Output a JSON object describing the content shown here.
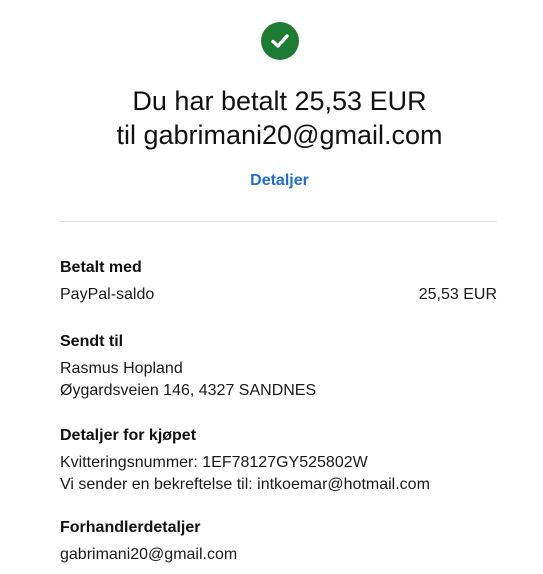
{
  "icon": "checkmark-circle-icon",
  "colors": {
    "success": "#1d7b34",
    "link": "#1f6fd6",
    "text": "#111111"
  },
  "headline": {
    "line1": "Du har betalt 25,53 EUR",
    "line2": "til gabrimani20@gmail.com"
  },
  "details_link": "Detaljer",
  "payment": {
    "title": "Betalt med",
    "method": "PayPal-saldo",
    "amount": "25,53 EUR"
  },
  "recipient": {
    "title": "Sendt til",
    "name": "Rasmus Hopland",
    "address": "Øygardsveien 146, 4327 SANDNES"
  },
  "purchase": {
    "title": "Detaljer for kjøpet",
    "receipt_number": "Kvitteringsnummer: 1EF78127GY525802W",
    "confirmation": "Vi sender en bekreftelse til: intkoemar@hotmail.com"
  },
  "merchant": {
    "title": "Forhandlerdetaljer",
    "email": "gabrimani20@gmail.com"
  }
}
